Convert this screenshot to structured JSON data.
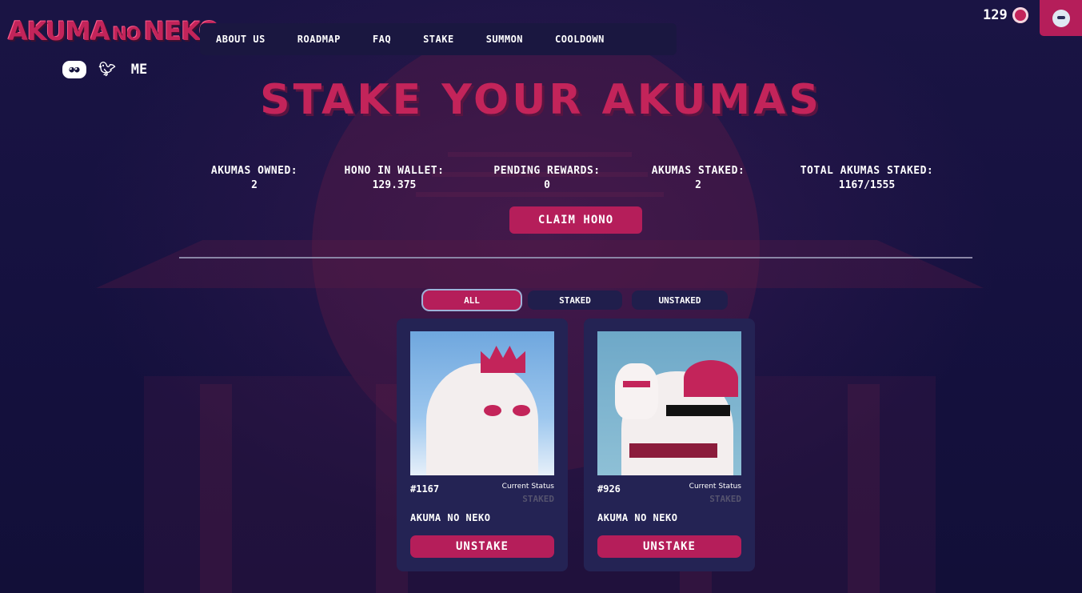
{
  "brand": {
    "logo_part1": "AKUMA",
    "logo_part2": "NO",
    "logo_part3": "NEKO"
  },
  "social": [
    "discord-icon",
    "twitter-icon",
    "magic-eden-icon"
  ],
  "nav": [
    {
      "label": "ABOUT US"
    },
    {
      "label": "ROADMAP"
    },
    {
      "label": "FAQ"
    },
    {
      "label": "STAKE"
    },
    {
      "label": "SUMMON"
    },
    {
      "label": "COOLDOWN"
    }
  ],
  "wallet": {
    "balance": "129"
  },
  "page": {
    "title": "STAKE YOUR AKUMAS",
    "stats": [
      {
        "label": "AKUMAS OWNED:",
        "value": "2"
      },
      {
        "label": "HONO IN WALLET:",
        "value": "129.375"
      },
      {
        "label": "PENDING REWARDS:",
        "value": "0"
      },
      {
        "label": "AKUMAS STAKED:",
        "value": "2"
      },
      {
        "label": "TOTAL AKUMAS STAKED:",
        "value": "1167/1555"
      }
    ],
    "claim_label": "CLAIM HONO"
  },
  "filters": [
    {
      "label": "ALL",
      "active": true
    },
    {
      "label": "STAKED",
      "active": false
    },
    {
      "label": "UNSTAKED",
      "active": false
    }
  ],
  "cards": [
    {
      "id": "#1167",
      "status_label": "Current Status",
      "status": "STAKED",
      "name": "AKUMA NO NEKO",
      "action": "UNSTAKE"
    },
    {
      "id": "#926",
      "status_label": "Current Status",
      "status": "STAKED",
      "name": "AKUMA NO NEKO",
      "action": "UNSTAKE"
    }
  ],
  "colors": {
    "accent": "#b51e5a",
    "background": "#12103a",
    "card": "#242354"
  }
}
